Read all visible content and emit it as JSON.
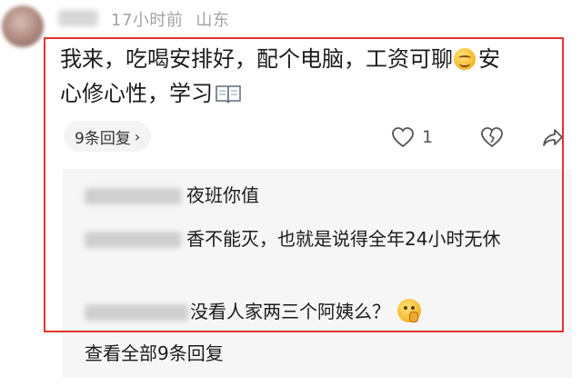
{
  "comment": {
    "time": "17小时前",
    "location": "山东",
    "text_line1": "我来，吃喝安排好，配个电脑，工资可聊",
    "text_line1_after_emoji": "安",
    "text_line2": "心修心性，学习",
    "emojis": [
      "smile-emoji",
      "book-emoji"
    ],
    "reply_chip_label": "9条回复",
    "like_count": "1"
  },
  "replies": [
    {
      "text": "夜班你值"
    },
    {
      "text": "香不能灭，也就是说得全年24小时无休"
    },
    {
      "text": "没看人家两三个阿姨么？",
      "emoji": "shush-emoji"
    }
  ],
  "view_all_label": "查看全部9条回复",
  "colors": {
    "highlight_border": "#e4342e",
    "meta_text": "#a3a3a3",
    "panel_bg": "#f6f6f6"
  }
}
